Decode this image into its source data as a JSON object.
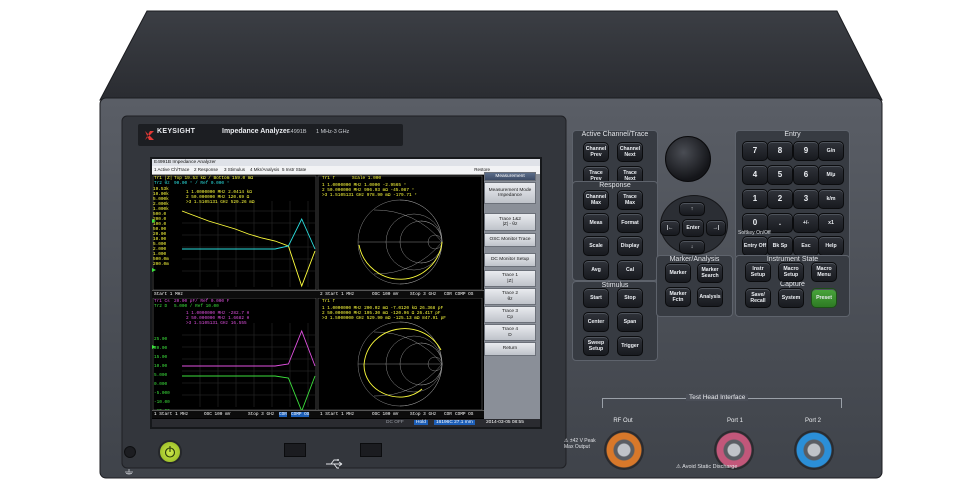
{
  "brand": {
    "name": "KEYSIGHT",
    "product": "Impedance Analyzer",
    "model": "E4991B",
    "range": "1 MHz-3 GHz"
  },
  "colors": {
    "panel": "#4a4e57",
    "screen_bg": "#000000",
    "trace_yellow": "#ffff3c",
    "trace_cyan": "#2be0e0",
    "trace_magenta": "#e050e0",
    "trace_green": "#3ce03c",
    "power_green": "#b7e02a",
    "port_orange": "#d8782a",
    "port_pink": "#c2577a",
    "port_blue": "#2b8fd8"
  },
  "screen": {
    "window_title": "E4991B Impedance Analyzer",
    "menu": [
      "1 Active Ch/Trace",
      "2 Response",
      "3 Stimulus",
      "4 Mkr/Analysis",
      "5 Instr State"
    ],
    "restore": "Restore",
    "ch1": {
      "tr1_label": "Tr1 |Z|",
      "tr1_scale": "Top 19.53 kΩ / Bottom 159.0 mΩ",
      "tr2_label": "Tr2 θz",
      "tr2_scale": "90.00 ° / Ref 0.000 °",
      "markers": [
        "1 1.0000000 MHz 2.0414 kΩ",
        "2 50.000000 MHz 120.69 Ω",
        ">3 1.5105131 GHz 529.26 mΩ"
      ],
      "y_ticks": [
        "19.53k",
        "10.00k",
        "5.000k",
        "2.000k",
        "1.000k",
        "500.0",
        "200.0",
        "100.0",
        "50.00",
        "20.00",
        "10.00",
        "5.000",
        "2.000",
        "1.000",
        "500.0m",
        "200.0m"
      ],
      "status": "Start 1 MHz"
    },
    "ch2": {
      "tr1_label": "Tr1 Γ",
      "tr1_scale": "Scale 1.000",
      "markers": [
        "1 1.0000000 MHz 1.0000 -2.9565 °",
        "2 50.000000 MHz 996.93 mΩ -45.087 °",
        ">3 1.5105131 GHz 978.90 mΩ -179.71 °"
      ],
      "status": [
        "2 Start 1 MHz",
        "OSC 100 mV",
        "Stop 3 GHz",
        "COR",
        "COMP OS"
      ]
    },
    "ch3": {
      "tr1_label": "Tr1 Cs",
      "tr1_scale": "20.00 pF/ Ref 0.000 F",
      "tr2_label": "Tr2 D",
      "tr2_scale": "5.000 / Ref 10.00",
      "markers": [
        "1 1.0000000 MHz -282.7 H",
        "2 50.000000 MHz 1.6682 H",
        ">3 1.5105131 GHz 16.555"
      ],
      "y_ticks": [
        "25.00",
        "20.00",
        "15.00",
        "10.00",
        "5.000",
        "0.000",
        "-5.000",
        "-10.00",
        "-15.00"
      ],
      "status": [
        "1 Start 1 MHz",
        "OSC 100 mV",
        "Stop 3 GHz",
        "COR",
        "COMP OS"
      ]
    },
    "ch4": {
      "tr1_label": "Tr1 Γ",
      "markers": [
        "1 1.0000000 MHz 200.02 mΩ -7.0120 kΩ 26.368 pF",
        "2 50.000000 MHz 195.30 mΩ -120.96 Ω 26.417 pF",
        ">3 1.5000000 GHz 529.90 mΩ -125.13 mΩ 847.91 pF"
      ],
      "status": [
        "1 Start 1 MHz",
        "OSC 100 mV",
        "Stop 3 GHz",
        "COR",
        "COMP OS"
      ]
    },
    "bottom_bar": {
      "state": "DC OFF",
      "hold": "Hold",
      "tempo": "16196C 27.1 mm",
      "datetime": "2014-03-05 08:55"
    },
    "softkeys": [
      {
        "title": "Measurement",
        "value": ""
      },
      {
        "title": "Measurement Mode",
        "value": "Impedance"
      },
      {
        "title": "Trace 1&2",
        "value": "|Z| - θz"
      },
      {
        "title": "OSC Monitor Trace",
        "value": ""
      },
      {
        "title": "DC Monitor Setup",
        "value": ""
      },
      {
        "title": "Trace 1",
        "value": "|Z|"
      },
      {
        "title": "Trace 2",
        "value": "θz"
      },
      {
        "title": "Trace 3",
        "value": "Cp"
      },
      {
        "title": "Trace 4",
        "value": "D"
      },
      {
        "title": "Return",
        "value": ""
      }
    ]
  },
  "chart_data": [
    {
      "type": "line",
      "name": "Channel 1 impedance sweep",
      "x": [
        0,
        1,
        2,
        3,
        4,
        5,
        6,
        7,
        8,
        9,
        10
      ],
      "series": [
        {
          "name": "Tr1 |Z|",
          "values": [
            6.0,
            5.5,
            5.0,
            4.6,
            4.2,
            3.7,
            3.3,
            3.0,
            2.5,
            -1.5,
            2.0
          ]
        },
        {
          "name": "Tr2 θz",
          "values": [
            -2.0,
            -2.0,
            -2.0,
            -2.0,
            -2.0,
            -2.0,
            -2.0,
            -2.0,
            -1.5,
            3.0,
            -2.0
          ]
        }
      ]
    },
    {
      "type": "line",
      "name": "Channel 3 Cs/D sweep",
      "x": [
        0,
        1,
        2,
        3,
        4,
        5,
        6,
        7,
        8,
        9,
        10
      ],
      "series": [
        {
          "name": "Tr1 Cs",
          "values": [
            0.5,
            0.5,
            0.5,
            0.5,
            0.5,
            0.5,
            0.5,
            0.5,
            0.7,
            4.0,
            0.5
          ]
        },
        {
          "name": "Tr2 D",
          "values": [
            -0.5,
            -0.5,
            -0.5,
            -0.5,
            -0.5,
            -0.5,
            -0.5,
            -0.5,
            -0.7,
            -4.0,
            -0.5
          ]
        }
      ]
    }
  ],
  "keys": {
    "active_title": "Active Channel/Trace",
    "active": [
      "Channel Prev",
      "Channel Next",
      "Trace Prev",
      "Trace Next"
    ],
    "response_title": "Response",
    "response": [
      "Channel Max",
      "Trace Max",
      "Meas",
      "Format",
      "Scale",
      "Display",
      "Avg",
      "Cal"
    ],
    "stimulus_title": "Stimulus",
    "stimulus": [
      "Start",
      "Stop",
      "Center",
      "Span",
      "Sweep Setup",
      "Trigger"
    ],
    "entry_title": "Entry",
    "entry": [
      "7",
      "8",
      "9",
      "G/n",
      "4",
      "5",
      "6",
      "M/μ",
      "1",
      "2",
      "3",
      "k/m",
      "0",
      ".",
      "+/-",
      "x1"
    ],
    "softkey_label": "Softkey On/Off",
    "entry2": [
      "Entry Off",
      "Bk Sp",
      "Esc",
      "Help"
    ],
    "nav": {
      "enter": "Enter",
      "up": "↑",
      "down": "↓",
      "left": "|←",
      "right": "→|"
    },
    "marker_title": "Marker/Analysis",
    "marker": [
      "Marker",
      "Marker Search",
      "Marker Fctn",
      "Analysis"
    ],
    "instr_title": "Instrument State",
    "instr": [
      "Instr Setup",
      "Macro Setup",
      "Macro Menu"
    ],
    "capture_title": "Capture",
    "capture": [
      "Save/ Recall",
      "System",
      "Preset"
    ]
  },
  "interface": {
    "title": "Test Head Interface",
    "rf_out": "RF Out",
    "port1": "Port 1",
    "port2": "Port 2",
    "warn_rf": "⚠ ±42 V Peak Max Output",
    "warn_static": "⚠ Avoid Static Discharge"
  },
  "usb_icon": "usb-icon"
}
